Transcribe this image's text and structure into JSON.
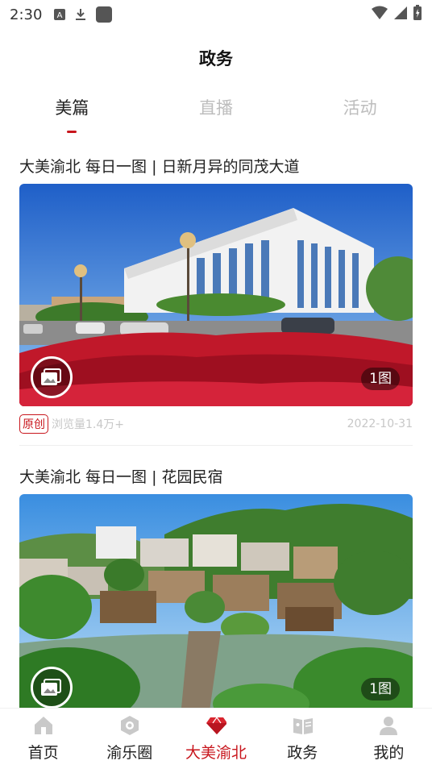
{
  "status_bar": {
    "time": "2:30",
    "icons": [
      "a-icon",
      "download-icon",
      "app-square-icon",
      "wifi-icon",
      "signal-icon",
      "battery-icon"
    ]
  },
  "header": {
    "title": "政务"
  },
  "tabs": [
    {
      "label": "美篇",
      "active": true
    },
    {
      "label": "直播",
      "active": false
    },
    {
      "label": "活动",
      "active": false
    }
  ],
  "articles": [
    {
      "title": "大美渝北 每日一图 | 日新月异的同茂大道",
      "image_count": "1图",
      "tag": "原创",
      "views": "浏览量1.4万+",
      "date": "2022-10-31"
    },
    {
      "title": "大美渝北 每日一图 | 花园民宿",
      "image_count": "1图"
    }
  ],
  "bottom_nav": [
    {
      "label": "首页",
      "icon": "home-icon"
    },
    {
      "label": "渝乐圈",
      "icon": "circle-icon"
    },
    {
      "label": "大美渝北",
      "icon": "gem-icon",
      "active": true
    },
    {
      "label": "政务",
      "icon": "book-icon"
    },
    {
      "label": "我的",
      "icon": "user-icon"
    }
  ],
  "colors": {
    "accent": "#c8161d",
    "inactive_tab": "#bdbdbd",
    "nav_icon": "#c9c9c9"
  }
}
